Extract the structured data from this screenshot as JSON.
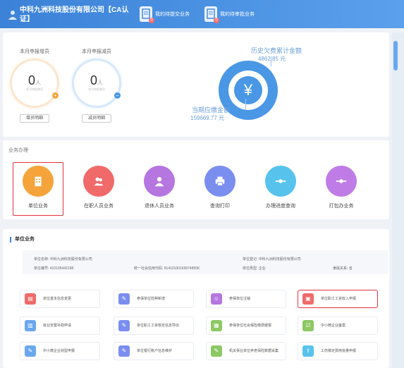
{
  "header": {
    "company": "中科九洲科技股份有限公司【CA认证】",
    "tasks": [
      {
        "label": "我的待提交业务",
        "badge": "0"
      },
      {
        "label": "我的待审批业务",
        "badge": "0"
      }
    ]
  },
  "stats": {
    "increase": {
      "title": "本月申报增员",
      "value": "0",
      "unit": "人",
      "sub": "本月申报增员",
      "detail": "增员明细"
    },
    "decrease": {
      "title": "本月申报减员",
      "value": "0",
      "unit": "人",
      "sub": "本月申报减员",
      "detail": "减员明细"
    },
    "arrears": {
      "title": "历史欠费累计金额",
      "value": "4862.85 元"
    },
    "payable": {
      "title": "当期应缴金额",
      "value": "159669.77 元"
    }
  },
  "business": {
    "title": "业务办理",
    "items": [
      {
        "label": "单位业务",
        "color": "#f4a43a"
      },
      {
        "label": "在职人员业务",
        "color": "#f06a6a"
      },
      {
        "label": "退休人员业务",
        "color": "#b576e0"
      },
      {
        "label": "查询打印",
        "color": "#7a8ef0"
      },
      {
        "label": "办理进度查询",
        "color": "#57c3ec"
      },
      {
        "label": "打包办业务",
        "color": "#c07ce6"
      }
    ]
  },
  "unit": {
    "title": "单位业务",
    "info": {
      "name_label": "单位名称:",
      "name": "中科九洲科技股份有限公司",
      "code_label": "单位编号:",
      "code": "410105442198",
      "credit_label": "统一社会信用代码:",
      "credit": "91410100169974855K",
      "reg_label": "单位登记:",
      "reg": "中科九洲科技股份有限公司",
      "type_label": "单位类型:",
      "type": "企业",
      "rel_label": "隶属关系:",
      "rel": "省"
    },
    "services": [
      {
        "label": "单位基本信息变更",
        "color": "#f06a6a"
      },
      {
        "label": "参保单位险种新增",
        "color": "#7a8ef0"
      },
      {
        "label": "参保单位注销",
        "color": "#b576e0"
      },
      {
        "label": "单位职工工资收入申报",
        "color": "#f06a6a"
      },
      {
        "label": "就业安置补助申请",
        "color": "#6aa8ee"
      },
      {
        "label": "单位职工工资核定信息导出",
        "color": "#7a8ef0"
      },
      {
        "label": "参保单位社会保险缴费缓报",
        "color": "#8cc864"
      },
      {
        "label": "中小微企业备案",
        "color": "#8cc864"
      },
      {
        "label": "中小微企业划型申报",
        "color": "#6aa8ee"
      },
      {
        "label": "单位银行账户信息维护",
        "color": "#7a8ef0"
      },
      {
        "label": "机关事业单位养老保险数据采集",
        "color": "#8cc864"
      },
      {
        "label": "工伤缴定费用批量申报",
        "color": "#57c3ec"
      }
    ]
  }
}
